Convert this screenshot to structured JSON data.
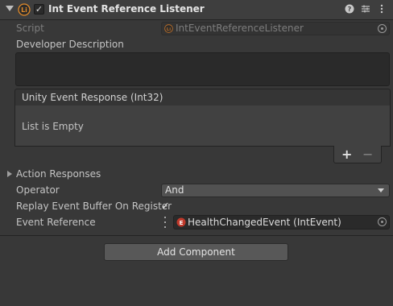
{
  "component": {
    "title": "Int Event Reference Listener",
    "enabled": true
  },
  "header_icons": {
    "help": "help-icon",
    "presets": "presets-icon",
    "menu": "context-menu-icon"
  },
  "fields": {
    "script_label": "Script",
    "script_value": "IntEventReferenceListener",
    "developer_description_label": "Developer Description",
    "developer_description_value": "",
    "event_response": {
      "header": "Unity Event Response (Int32)",
      "empty_text": "List is Empty",
      "add_label": "+",
      "remove_label": "−"
    },
    "action_responses_label": "Action Responses",
    "operator_label": "Operator",
    "operator_value": "And",
    "replay_label": "Replay Event Buffer On Register",
    "replay_checked": true,
    "event_reference_label": "Event Reference",
    "event_reference_value": "HealthChangedEvent (IntEvent)"
  },
  "add_component_label": "Add Component",
  "colors": {
    "background": "#383838",
    "header": "#3e3e3e",
    "icon_red": "#c0392b"
  }
}
